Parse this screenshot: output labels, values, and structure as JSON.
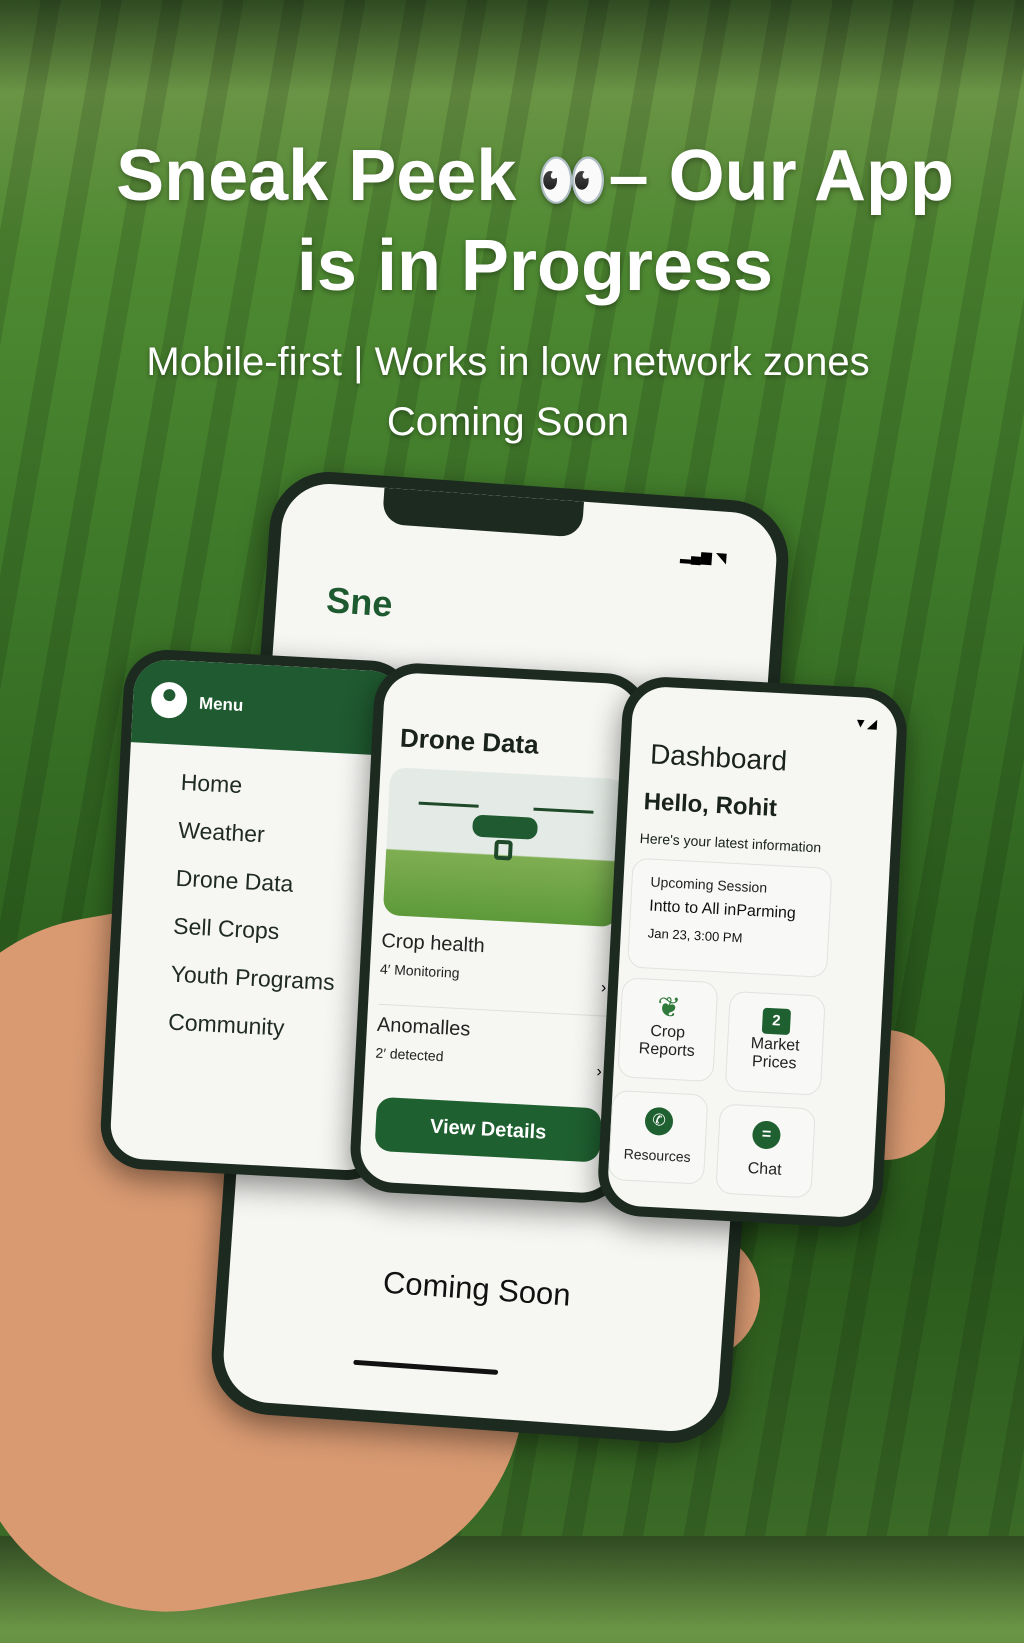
{
  "headline": {
    "line1": "Sneak Peek",
    "eyes": "👀",
    "line1b": "– Our App",
    "line2": "is in Progress"
  },
  "subtitle": {
    "line1": "Mobile-first | Works in low network zones",
    "line2": "Coming Soon"
  },
  "back_phone": {
    "title": "Sne",
    "footer": "Coming Soon"
  },
  "menu_phone": {
    "header": "Menu",
    "items": [
      "Home",
      "Weather",
      "Drone Data",
      "Sell Crops",
      "Youth Programs",
      "Community"
    ]
  },
  "drone_phone": {
    "title": "Drone Data",
    "rows": [
      {
        "title": "Crop health",
        "count": "4",
        "detail": "Monitoring"
      },
      {
        "title": "Anomalles",
        "count": "2",
        "detail": "detected"
      }
    ],
    "button": "View Details"
  },
  "dashboard_phone": {
    "title": "Dashboard",
    "greeting": "Hello, Rohit",
    "subtitle": "Here's your latest information",
    "session": {
      "label": "Upcoming Session",
      "name": "Intto to All inParming",
      "time": "Jan 23, 3:00 PM"
    },
    "tiles": [
      {
        "label": "Crop Reports",
        "icon": "leaf-icon"
      },
      {
        "label": "Market Prices",
        "badge": "2",
        "icon": "badge-icon"
      },
      {
        "label": "Resources",
        "icon": "phone-icon"
      },
      {
        "label": "Chat",
        "icon": "chat-icon"
      }
    ]
  },
  "colors": {
    "brand_green": "#1f6030",
    "screen": "#f6f6f3"
  }
}
